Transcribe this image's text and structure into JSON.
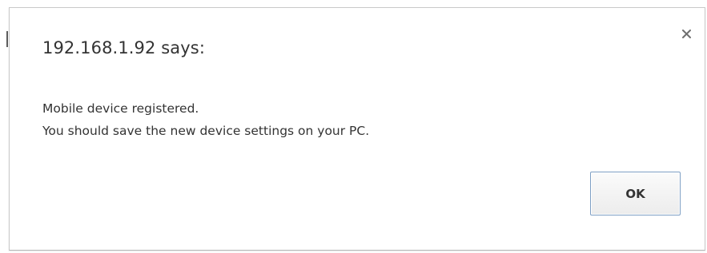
{
  "dialog": {
    "title": "192.168.1.92 says:",
    "message_line_1": "Mobile device registered.",
    "message_line_2": "You should save the new device settings on your PC.",
    "ok_label": "OK",
    "close_icon": "close-icon"
  },
  "colors": {
    "text": "#333333",
    "button_border": "#7e9fc4",
    "dialog_border": "#c9c9c9",
    "background": "#ffffff"
  }
}
